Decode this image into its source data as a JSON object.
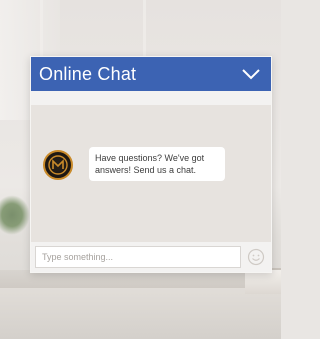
{
  "chat": {
    "title": "Online Chat",
    "collapse_icon": "chevron-down-icon",
    "message": "Have questions? We've got answers! Send us a chat.",
    "avatar_icon": "brand-logo-icon",
    "input_placeholder": "Type something...",
    "emoji_icon": "smiley-icon"
  },
  "colors": {
    "header": "#3c63b3",
    "header_text": "#ffffff",
    "avatar_ring": "#c98a2a"
  }
}
